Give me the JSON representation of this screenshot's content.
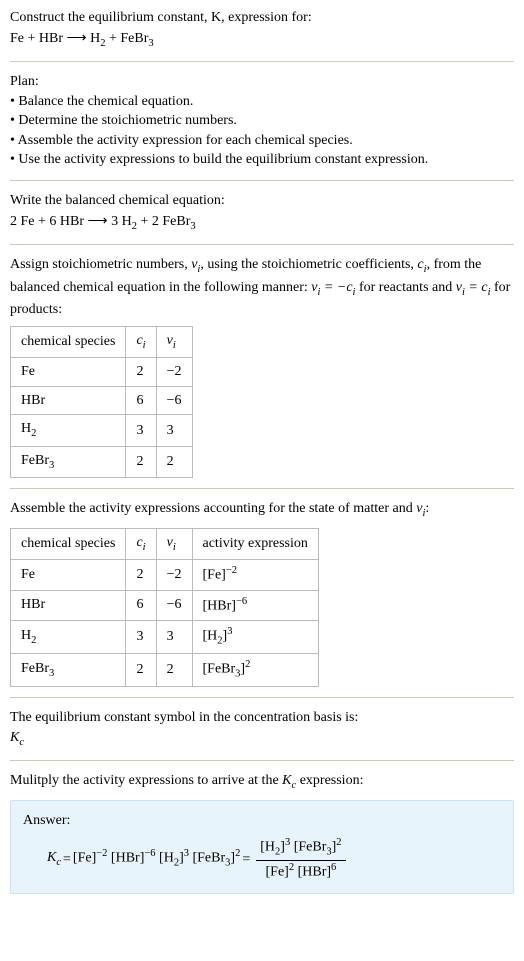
{
  "intro": {
    "line1": "Construct the equilibrium constant, K, expression for:",
    "eq": "Fe + HBr ⟶ H₂ + FeBr₃"
  },
  "plan": {
    "heading": "Plan:",
    "items": [
      "• Balance the chemical equation.",
      "• Determine the stoichiometric numbers.",
      "• Assemble the activity expression for each chemical species.",
      "• Use the activity expressions to build the equilibrium constant expression."
    ]
  },
  "balanced": {
    "heading": "Write the balanced chemical equation:",
    "eq": "2 Fe + 6 HBr ⟶ 3 H₂ + 2 FeBr₃"
  },
  "assign": {
    "text_a": "Assign stoichiometric numbers, ",
    "nu": "ν",
    "sub_i": "i",
    "text_b": ", using the stoichiometric coefficients, ",
    "c": "c",
    "text_c": ", from the balanced chemical equation in the following manner: ",
    "rel1": "νᵢ = −cᵢ",
    "text_d": " for reactants and ",
    "rel2": "νᵢ = cᵢ",
    "text_e": " for products:"
  },
  "table1": {
    "headers": {
      "species": "chemical species",
      "c": "cᵢ",
      "nu": "νᵢ"
    },
    "rows": [
      {
        "species": "Fe",
        "c": "2",
        "nu": "−2"
      },
      {
        "species": "HBr",
        "c": "6",
        "nu": "−6"
      },
      {
        "species": "H₂",
        "c": "3",
        "nu": "3"
      },
      {
        "species": "FeBr₃",
        "c": "2",
        "nu": "2"
      }
    ]
  },
  "assemble": {
    "text_a": "Assemble the activity expressions accounting for the state of matter and ",
    "nu": "νᵢ",
    "text_b": ":"
  },
  "table2": {
    "headers": {
      "species": "chemical species",
      "c": "cᵢ",
      "nu": "νᵢ",
      "act": "activity expression"
    },
    "rows": [
      {
        "species": "Fe",
        "c": "2",
        "nu": "−2",
        "act": "[Fe]⁻²"
      },
      {
        "species": "HBr",
        "c": "6",
        "nu": "−6",
        "act": "[HBr]⁻⁶"
      },
      {
        "species": "H₂",
        "c": "3",
        "nu": "3",
        "act": "[H₂]³"
      },
      {
        "species": "FeBr₃",
        "c": "2",
        "nu": "2",
        "act": "[FeBr₃]²"
      }
    ]
  },
  "symbol": {
    "text": "The equilibrium constant symbol in the concentration basis is:",
    "kc": "K",
    "kc_sub": "c"
  },
  "multiply": {
    "text_a": "Mulitply the activity expressions to arrive at the ",
    "kc": "K",
    "kc_sub": "c",
    "text_b": " expression:"
  },
  "answer": {
    "label": "Answer:",
    "kc": "K",
    "kc_sub": "c",
    "eq": " = ",
    "flat": "[Fe]⁻² [HBr]⁻⁶ [H₂]³ [FeBr₃]²",
    "eq2": " = ",
    "num": "[H₂]³ [FeBr₃]²",
    "den": "[Fe]² [HBr]⁶"
  }
}
